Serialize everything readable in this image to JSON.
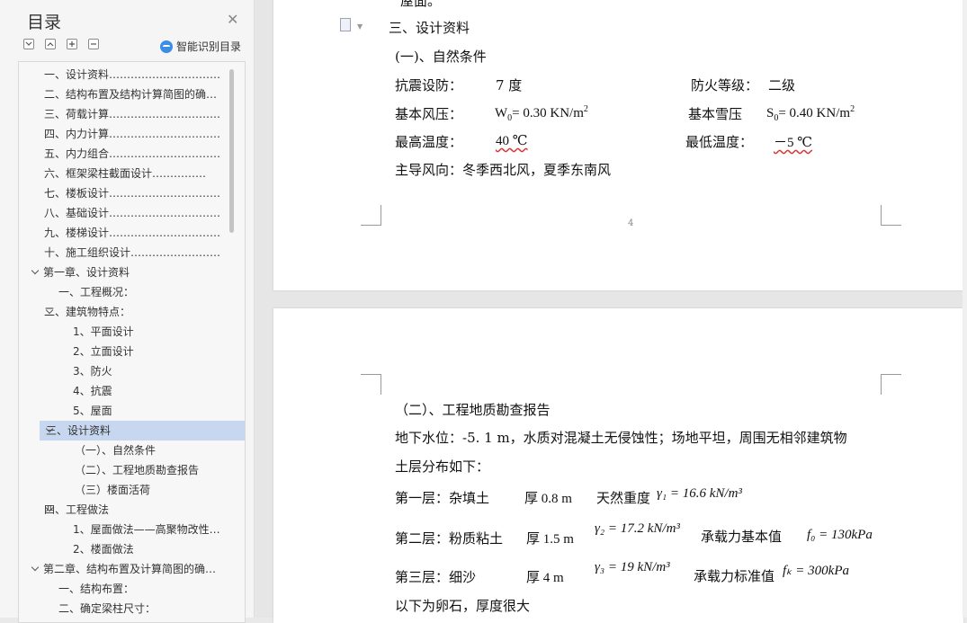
{
  "outline": {
    "title": "目录",
    "smart_label": "智能识别目录",
    "items": [
      {
        "label": "一、设计资料……………………………",
        "level": 1
      },
      {
        "label": "二、结构布置及结构计算简图的确…",
        "level": 1
      },
      {
        "label": "三、荷载计算……………………………",
        "level": 1
      },
      {
        "label": "四、内力计算……………………………",
        "level": 1
      },
      {
        "label": "五、内力组合……………………………",
        "level": 1
      },
      {
        "label": "六、框架梁柱截面设计……………",
        "level": 1
      },
      {
        "label": "七、楼板设计……………………………",
        "level": 1
      },
      {
        "label": "八、基础设计……………………………",
        "level": 1
      },
      {
        "label": "九、楼梯设计……………………………",
        "level": 1
      },
      {
        "label": "十、施工组织设计………………………",
        "level": 1
      },
      {
        "label": "第一章、设计资料",
        "level": 0
      },
      {
        "label": "一、工程概况：",
        "level": 2
      },
      {
        "label": "二、建筑物特点：",
        "level": 1
      },
      {
        "label": "1、平面设计",
        "level": 3
      },
      {
        "label": "2、立面设计",
        "level": 3
      },
      {
        "label": "3、防火",
        "level": 3
      },
      {
        "label": "4、抗震",
        "level": 3
      },
      {
        "label": "5、屋面",
        "level": 3
      },
      {
        "label": "三、设计资料",
        "level": 1
      },
      {
        "label": "（一）、自然条件",
        "level": 4
      },
      {
        "label": "（二）、工程地质勘查报告",
        "level": 4
      },
      {
        "label": "（三）楼面活荷",
        "level": 4
      },
      {
        "label": "四、工程做法",
        "level": 1
      },
      {
        "label": "1、屋面做法——高聚物改性…",
        "level": 3
      },
      {
        "label": "2、楼面做法",
        "level": 3
      },
      {
        "label": "第二章、结构布置及计算简图的确…",
        "level": 0
      },
      {
        "label": "一、结构布置：",
        "level": 2
      },
      {
        "label": "二、确定梁柱尺寸：",
        "level": 2
      }
    ]
  },
  "page1": {
    "top_line": "屋面。",
    "heading": "三、设计资料",
    "subheading": "(一)、自然条件",
    "seismic_label": "抗震设防：",
    "seismic_value": "7  度",
    "fire_label": "防火等级：",
    "fire_value": "二级",
    "wind_label": "基本风压：",
    "wind_value_pre": "W",
    "wind_value_sub": "0",
    "wind_value_post": "= 0.30 KN/m",
    "wind_value_sup": "2",
    "snow_label": "基本雪压",
    "snow_value_pre": "S",
    "snow_value_sub": "0",
    "snow_value_post": "= 0.40 KN/m",
    "snow_value_sup": "2",
    "max_temp_label": "最高温度：",
    "max_temp_value": "40 ℃",
    "min_temp_label": "最低温度：",
    "min_temp_value": "－5 ℃",
    "wind_dir": "主导风向：冬季西北风，夏季东南风",
    "page_number": "4"
  },
  "page2": {
    "subheading": "（二）、工程地质勘查报告",
    "water_line": "地下水位：-5. 1 m，水质对混凝土无侵蚀性；场地平坦，周围无相邻建筑物",
    "soil_intro": "土层分布如下：",
    "layer1_name": "第一层：杂填土",
    "layer1_thick": "厚 0.8 m",
    "layer1_weight_label": "天然重度",
    "layer1_formula": "γ₁ = 16.6 kN/m³",
    "layer2_name": "第二层：粉质粘土",
    "layer2_thick": "厚 1.5 m",
    "layer2_formula": "γ₂ = 17.2 kN/m³",
    "layer2_bearing_label": "承载力基本值",
    "layer2_bearing": "f₀ = 130kPa",
    "layer3_name": "第三层：细沙",
    "layer3_thick": "厚 4 m",
    "layer3_formula": "γ₃ = 19 kN/m³",
    "layer3_bearing_label": "承载力标准值",
    "layer3_bearing": "fₖ = 300kPa",
    "below_line": "以下为卵石，厚度很大"
  }
}
